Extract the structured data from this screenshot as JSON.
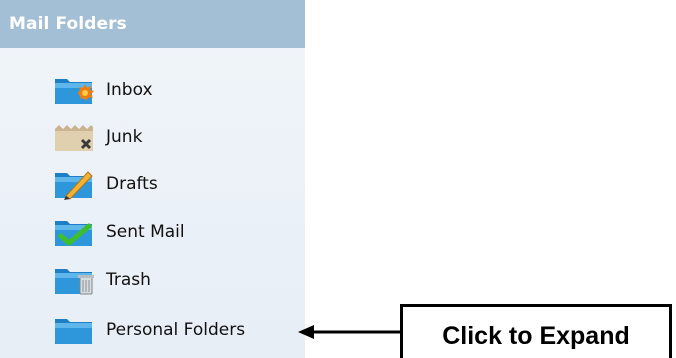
{
  "panel": {
    "title": "Mail Folders",
    "folders": [
      {
        "label": "Inbox",
        "icon": "inbox-folder-icon"
      },
      {
        "label": "Junk",
        "icon": "junk-folder-icon"
      },
      {
        "label": "Drafts",
        "icon": "drafts-folder-icon"
      },
      {
        "label": "Sent Mail",
        "icon": "sent-mail-folder-icon"
      },
      {
        "label": "Trash",
        "icon": "trash-folder-icon"
      },
      {
        "label": "Personal Folders",
        "icon": "personal-folder-icon"
      }
    ]
  },
  "callout": {
    "text": "Click to Expand",
    "arrow_icon": "left-arrow-icon"
  },
  "colors": {
    "header_bg": "#a3bfd6",
    "folder_blue": "#2b8fd6",
    "junk_tan": "#d6c4a4",
    "sent_check": "#3cbf2a"
  }
}
